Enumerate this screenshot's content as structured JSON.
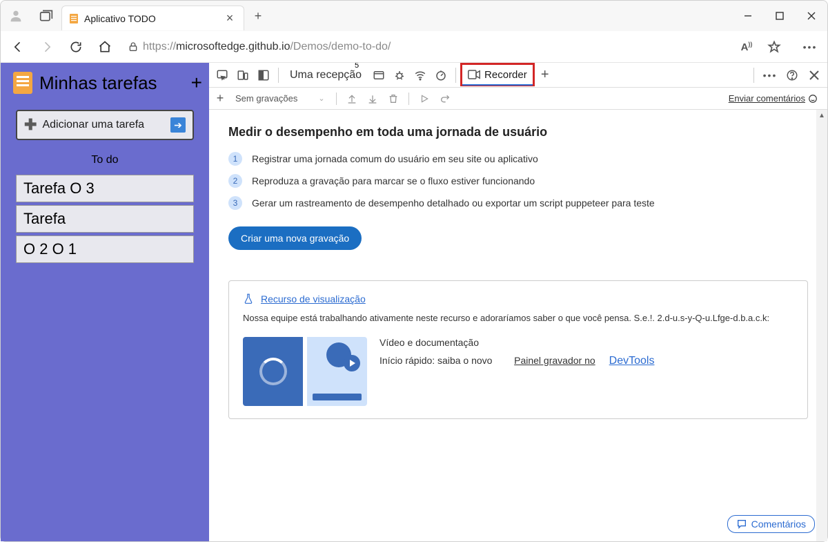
{
  "browser": {
    "tab_title": "Aplicativo TODO",
    "url_prefix": "https://",
    "url_host": "microsoftedge.github.io",
    "url_path": "/Demos/demo-to-do/"
  },
  "todo_app": {
    "title": "Minhas tarefas",
    "add_label": "Adicionar uma tarefa",
    "section_label": "To do",
    "tasks": [
      "Tarefa O 3",
      "Tarefa",
      "O 2 O 1"
    ]
  },
  "devtools": {
    "tabs": {
      "label": "Uma recepção",
      "overflow_badge": "5",
      "active_tab": "Recorder"
    },
    "toolbar": {
      "dropdown": "Sem gravações",
      "feedback": "Enviar comentários"
    },
    "panel": {
      "heading": "Medir o desempenho em toda uma jornada de usuário",
      "steps": [
        "Registrar uma jornada comum do usuário em seu site ou aplicativo",
        "Reproduza a gravação para marcar se o fluxo estiver funcionando",
        "Gerar um rastreamento de desempenho detalhado ou exportar um script puppeteer para teste"
      ],
      "cta": "Criar uma nova gravação"
    },
    "preview": {
      "title": "Recurso de visualização",
      "desc": "Nossa equipe está trabalhando ativamente neste recurso e adoraríamos saber o que você pensa. S.e.!. 2.d-u.s-y-Q-u.Lfge-d.b.a.c.k:",
      "video_label": "Vídeo e documentação",
      "quickstart": "Início rápido: saiba o novo",
      "panel_label": "Painel gravador no",
      "link": "DevTools"
    },
    "comments_btn": "Comentários"
  }
}
